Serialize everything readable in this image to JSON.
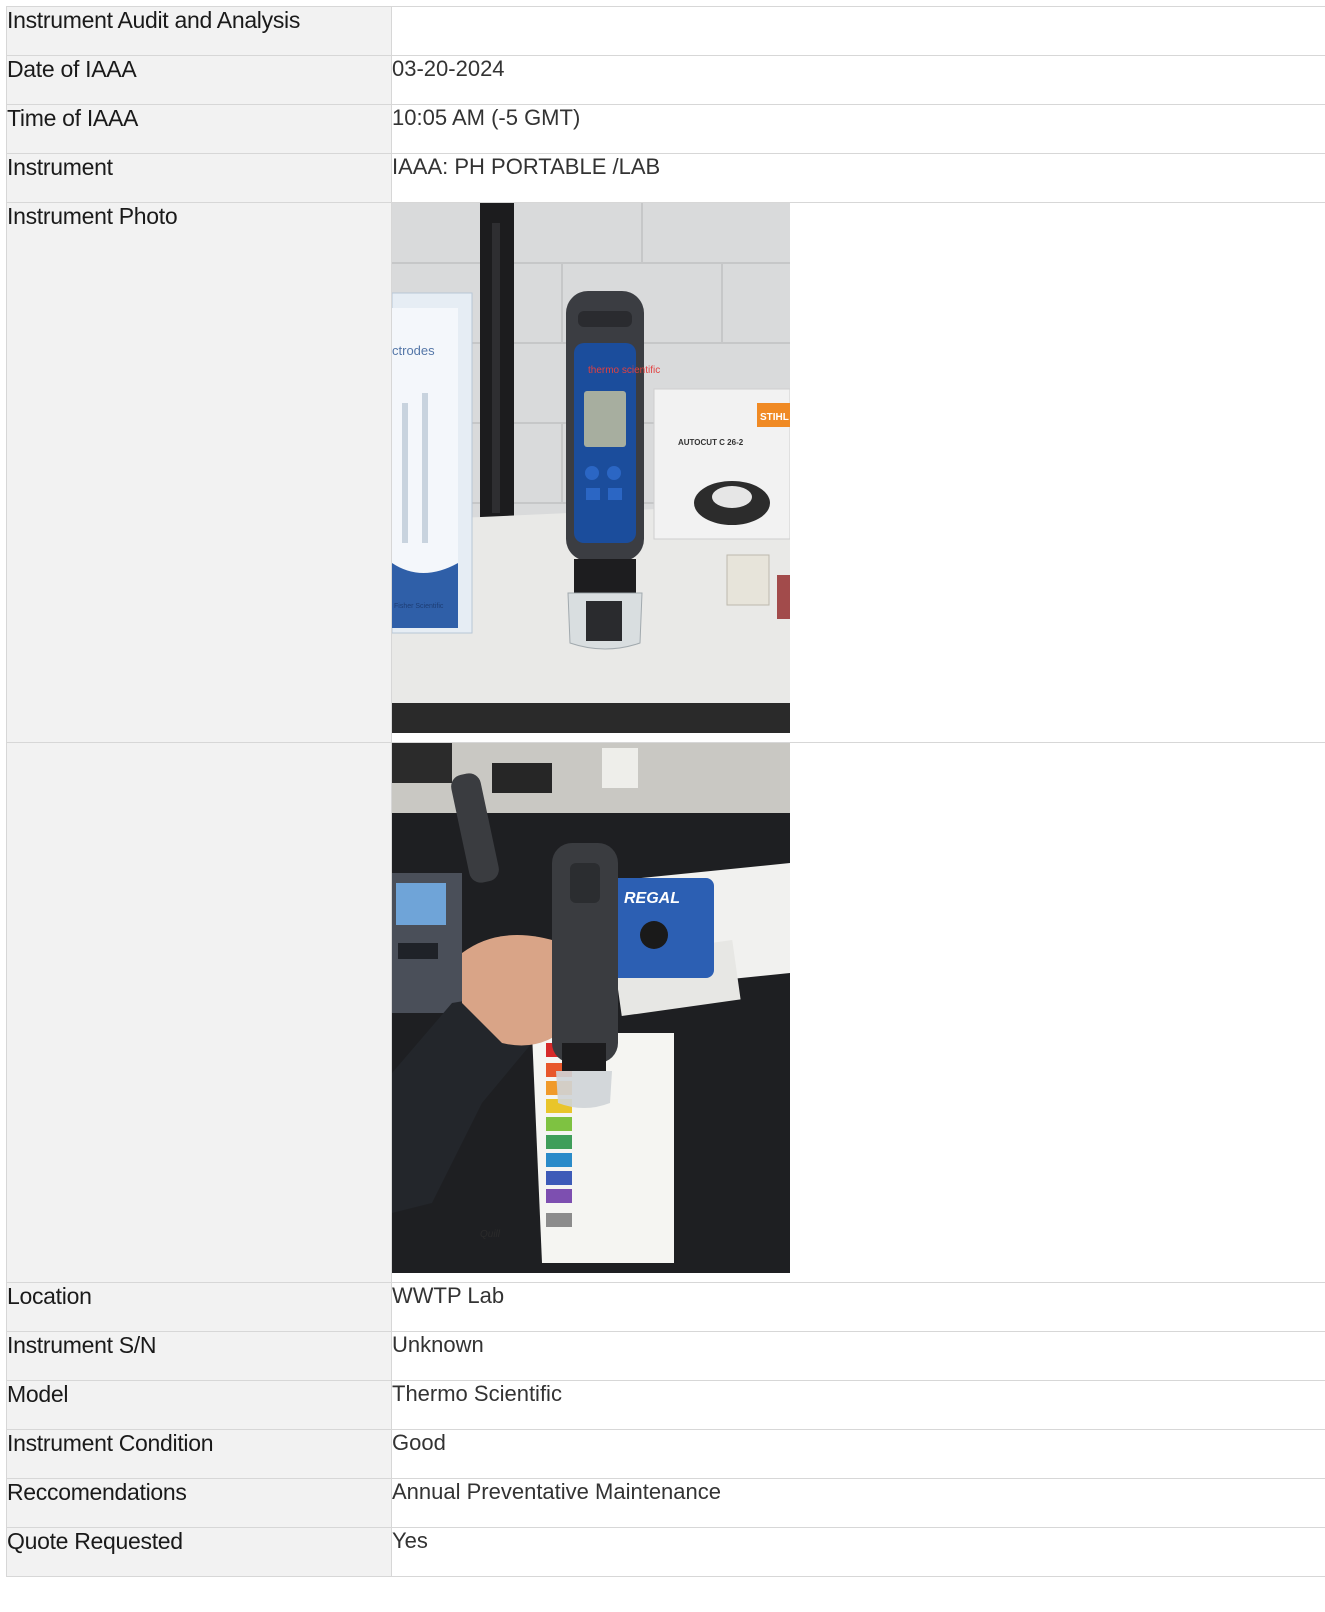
{
  "rows": {
    "header": {
      "label": "Instrument Audit and Analysis",
      "value": ""
    },
    "date": {
      "label": "Date of IAAA",
      "value": "03-20-2024"
    },
    "time": {
      "label": "Time of IAAA",
      "value": "10:05 AM (-5 GMT)"
    },
    "instrument": {
      "label": "Instrument",
      "value": "IAAA: PH PORTABLE /LAB"
    },
    "photo": {
      "label": "Instrument Photo"
    },
    "photo2": {
      "label": ""
    },
    "location": {
      "label": "Location",
      "value": "WWTP Lab"
    },
    "serial": {
      "label": "Instrument S/N",
      "value": "Unknown"
    },
    "model": {
      "label": "Model",
      "value": "Thermo Scientific"
    },
    "condition": {
      "label": "Instrument Condition",
      "value": "Good"
    },
    "recommendations": {
      "label": "Reccomendations",
      "value": "Annual Preventative Maintenance"
    },
    "quote": {
      "label": "Quote Requested",
      "value": "Yes"
    }
  },
  "photo1_text": {
    "brand": "thermo scientific",
    "box_left": "ctrodes",
    "box_left_brand": "Fisher Scientific",
    "box_right_brand": "STIHL",
    "box_right_product": "AUTOCUT C 26-2"
  },
  "photo2_text": {
    "device_brand": "REGAL",
    "binder_brand": "Quill"
  },
  "colors": {
    "label_bg": "#f2f2f2",
    "border": "#d7d7d7"
  }
}
